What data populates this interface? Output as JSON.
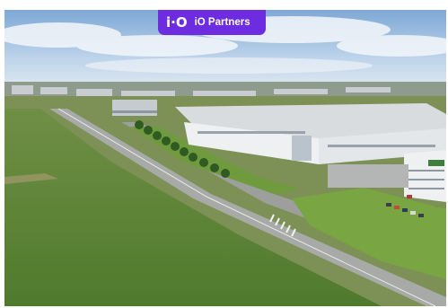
{
  "badge": {
    "logo": "i·O",
    "label": "iO Partners",
    "color": "#6d2ce0"
  },
  "photo": {
    "subject": "aerial-view-industrial-logistics-park"
  }
}
